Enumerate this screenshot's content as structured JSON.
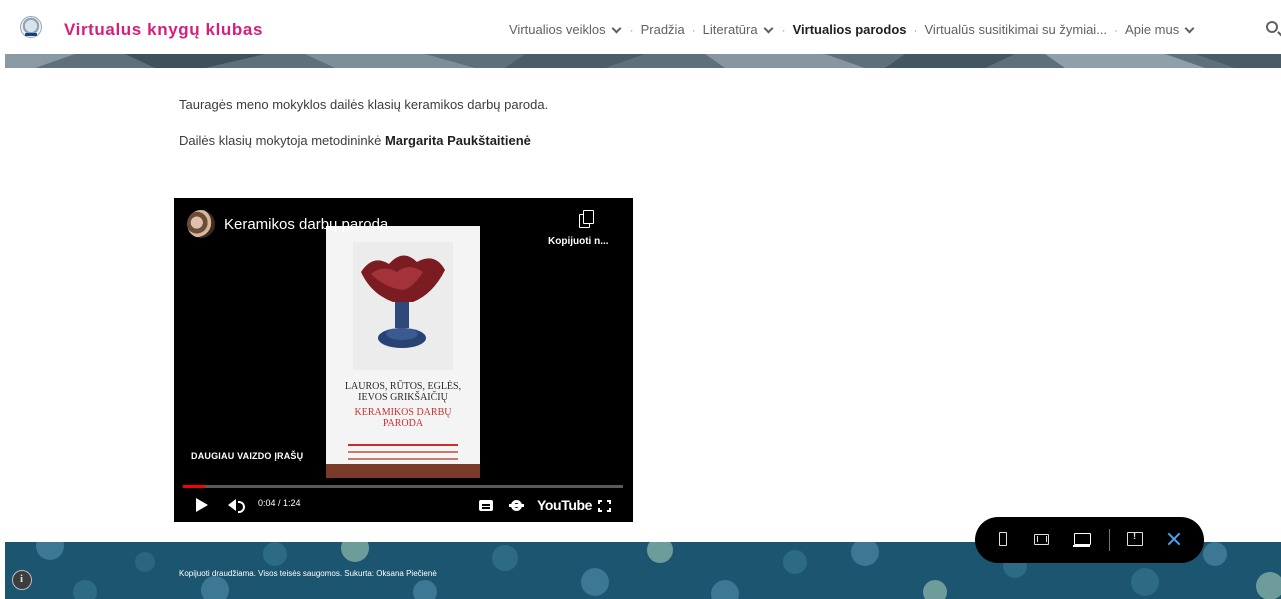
{
  "header": {
    "site_title": "Virtualus knygų klubas",
    "nav": [
      {
        "label": "Virtualios veiklos",
        "dropdown": true,
        "active": false
      },
      {
        "label": "Pradžia",
        "dropdown": false,
        "active": false
      },
      {
        "label": "Literatūra",
        "dropdown": true,
        "active": false
      },
      {
        "label": "Virtualios parodos",
        "dropdown": false,
        "active": true
      },
      {
        "label": "Virtualūs susitikimai su žymiai...",
        "dropdown": false,
        "active": false
      },
      {
        "label": "Apie mus",
        "dropdown": true,
        "active": false
      }
    ],
    "separator": "·",
    "search_icon": "search-icon",
    "title_color": "#d61f7c"
  },
  "content": {
    "paragraph1": "Tauragės meno mokyklos dailės klasių keramikos darbų paroda.",
    "paragraph2_prefix": "Dailės klasių mokytoja metodininkė",
    "paragraph2_name": "Margarita Paukštaitienė"
  },
  "video": {
    "title": "Keramikos darbų paroda",
    "copy_label": "Kopijuoti n...",
    "more_videos": "DAUGIAU VAIZDO ĮRAŠŲ",
    "time": "0:04 / 1:24",
    "progress": 0.05,
    "logo": "YouTube",
    "poster_heading": [
      "LAUROS, RŪTOS, EGLĖS,",
      "IEVOS GRIKŠAIČIŲ"
    ],
    "poster_subheading": [
      "KERAMIKOS DARBŲ",
      "PARODA"
    ],
    "progress_color": "#ff0000"
  },
  "footer": {
    "text": "Kopijuoti draudžiama. Visos teisės saugomos. Sukurta: Oksana Piečienė",
    "background": "#1c5570"
  },
  "toolbar": {
    "icons": [
      "phone-view-icon",
      "tablet-view-icon",
      "laptop-view-icon",
      "feedback-icon",
      "close-icon"
    ]
  }
}
